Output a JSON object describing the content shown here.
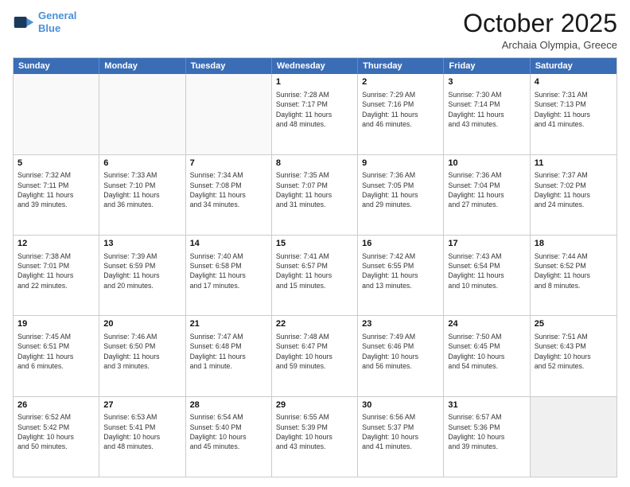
{
  "header": {
    "logo_line1": "General",
    "logo_line2": "Blue",
    "month": "October 2025",
    "location": "Archaia Olympia, Greece"
  },
  "weekdays": [
    "Sunday",
    "Monday",
    "Tuesday",
    "Wednesday",
    "Thursday",
    "Friday",
    "Saturday"
  ],
  "rows": [
    [
      {
        "day": "",
        "text": ""
      },
      {
        "day": "",
        "text": ""
      },
      {
        "day": "",
        "text": ""
      },
      {
        "day": "1",
        "text": "Sunrise: 7:28 AM\nSunset: 7:17 PM\nDaylight: 11 hours\nand 48 minutes."
      },
      {
        "day": "2",
        "text": "Sunrise: 7:29 AM\nSunset: 7:16 PM\nDaylight: 11 hours\nand 46 minutes."
      },
      {
        "day": "3",
        "text": "Sunrise: 7:30 AM\nSunset: 7:14 PM\nDaylight: 11 hours\nand 43 minutes."
      },
      {
        "day": "4",
        "text": "Sunrise: 7:31 AM\nSunset: 7:13 PM\nDaylight: 11 hours\nand 41 minutes."
      }
    ],
    [
      {
        "day": "5",
        "text": "Sunrise: 7:32 AM\nSunset: 7:11 PM\nDaylight: 11 hours\nand 39 minutes."
      },
      {
        "day": "6",
        "text": "Sunrise: 7:33 AM\nSunset: 7:10 PM\nDaylight: 11 hours\nand 36 minutes."
      },
      {
        "day": "7",
        "text": "Sunrise: 7:34 AM\nSunset: 7:08 PM\nDaylight: 11 hours\nand 34 minutes."
      },
      {
        "day": "8",
        "text": "Sunrise: 7:35 AM\nSunset: 7:07 PM\nDaylight: 11 hours\nand 31 minutes."
      },
      {
        "day": "9",
        "text": "Sunrise: 7:36 AM\nSunset: 7:05 PM\nDaylight: 11 hours\nand 29 minutes."
      },
      {
        "day": "10",
        "text": "Sunrise: 7:36 AM\nSunset: 7:04 PM\nDaylight: 11 hours\nand 27 minutes."
      },
      {
        "day": "11",
        "text": "Sunrise: 7:37 AM\nSunset: 7:02 PM\nDaylight: 11 hours\nand 24 minutes."
      }
    ],
    [
      {
        "day": "12",
        "text": "Sunrise: 7:38 AM\nSunset: 7:01 PM\nDaylight: 11 hours\nand 22 minutes."
      },
      {
        "day": "13",
        "text": "Sunrise: 7:39 AM\nSunset: 6:59 PM\nDaylight: 11 hours\nand 20 minutes."
      },
      {
        "day": "14",
        "text": "Sunrise: 7:40 AM\nSunset: 6:58 PM\nDaylight: 11 hours\nand 17 minutes."
      },
      {
        "day": "15",
        "text": "Sunrise: 7:41 AM\nSunset: 6:57 PM\nDaylight: 11 hours\nand 15 minutes."
      },
      {
        "day": "16",
        "text": "Sunrise: 7:42 AM\nSunset: 6:55 PM\nDaylight: 11 hours\nand 13 minutes."
      },
      {
        "day": "17",
        "text": "Sunrise: 7:43 AM\nSunset: 6:54 PM\nDaylight: 11 hours\nand 10 minutes."
      },
      {
        "day": "18",
        "text": "Sunrise: 7:44 AM\nSunset: 6:52 PM\nDaylight: 11 hours\nand 8 minutes."
      }
    ],
    [
      {
        "day": "19",
        "text": "Sunrise: 7:45 AM\nSunset: 6:51 PM\nDaylight: 11 hours\nand 6 minutes."
      },
      {
        "day": "20",
        "text": "Sunrise: 7:46 AM\nSunset: 6:50 PM\nDaylight: 11 hours\nand 3 minutes."
      },
      {
        "day": "21",
        "text": "Sunrise: 7:47 AM\nSunset: 6:48 PM\nDaylight: 11 hours\nand 1 minute."
      },
      {
        "day": "22",
        "text": "Sunrise: 7:48 AM\nSunset: 6:47 PM\nDaylight: 10 hours\nand 59 minutes."
      },
      {
        "day": "23",
        "text": "Sunrise: 7:49 AM\nSunset: 6:46 PM\nDaylight: 10 hours\nand 56 minutes."
      },
      {
        "day": "24",
        "text": "Sunrise: 7:50 AM\nSunset: 6:45 PM\nDaylight: 10 hours\nand 54 minutes."
      },
      {
        "day": "25",
        "text": "Sunrise: 7:51 AM\nSunset: 6:43 PM\nDaylight: 10 hours\nand 52 minutes."
      }
    ],
    [
      {
        "day": "26",
        "text": "Sunrise: 6:52 AM\nSunset: 5:42 PM\nDaylight: 10 hours\nand 50 minutes."
      },
      {
        "day": "27",
        "text": "Sunrise: 6:53 AM\nSunset: 5:41 PM\nDaylight: 10 hours\nand 48 minutes."
      },
      {
        "day": "28",
        "text": "Sunrise: 6:54 AM\nSunset: 5:40 PM\nDaylight: 10 hours\nand 45 minutes."
      },
      {
        "day": "29",
        "text": "Sunrise: 6:55 AM\nSunset: 5:39 PM\nDaylight: 10 hours\nand 43 minutes."
      },
      {
        "day": "30",
        "text": "Sunrise: 6:56 AM\nSunset: 5:37 PM\nDaylight: 10 hours\nand 41 minutes."
      },
      {
        "day": "31",
        "text": "Sunrise: 6:57 AM\nSunset: 5:36 PM\nDaylight: 10 hours\nand 39 minutes."
      },
      {
        "day": "",
        "text": ""
      }
    ]
  ]
}
